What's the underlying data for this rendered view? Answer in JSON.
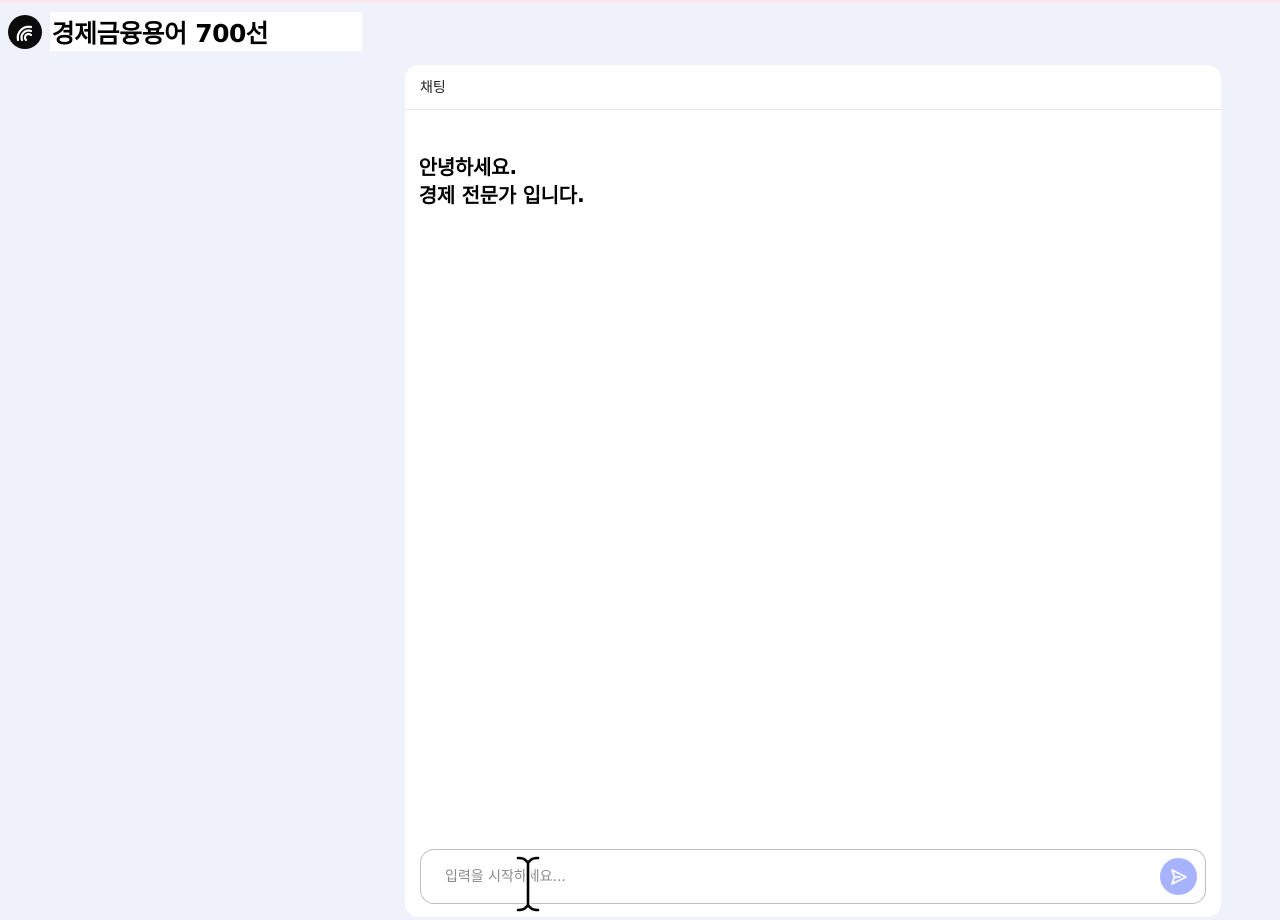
{
  "app": {
    "title": "경제금융용어 700선",
    "logo_icon": "signal-arcs-icon"
  },
  "chat": {
    "header_label": "채팅",
    "messages": [
      {
        "role": "assistant",
        "text": "안녕하세요.\n경제 전문가 입니다."
      }
    ],
    "input": {
      "value": "",
      "placeholder": "입력을 시작하세요..."
    },
    "send_icon": "send-arrow-icon"
  },
  "colors": {
    "background": "#eff2fa",
    "panel": "#ffffff",
    "send_button": "#a7b3ff",
    "logo": "#0b0b0b"
  }
}
